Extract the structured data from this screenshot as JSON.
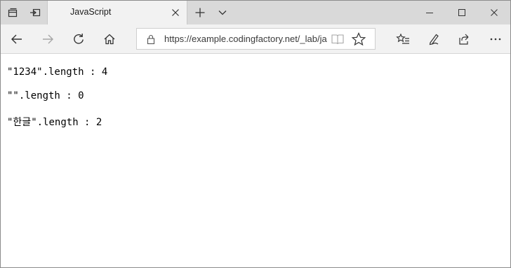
{
  "tab": {
    "title": "JavaScript"
  },
  "address": {
    "url": "https://example.codingfactory.net/_lab/ja"
  },
  "page": {
    "lines": [
      "\"1234\".length : 4",
      "\"\".length : 0",
      "\"한글\".length : 2"
    ]
  },
  "icons": {
    "tab_actions": "tab-actions-icon",
    "set_aside": "set-aside-tabs-icon",
    "close_tab": "close-icon",
    "new_tab": "plus-icon",
    "tab_preview": "chevron-down-icon",
    "minimize": "minimize-icon",
    "maximize": "maximize-icon",
    "close_window": "close-icon",
    "back": "back-arrow-icon",
    "forward": "forward-arrow-icon",
    "refresh": "refresh-icon",
    "home": "home-icon",
    "lock": "lock-icon",
    "reading_view": "book-icon",
    "favorite": "star-icon",
    "favorites_hub": "favorites-list-icon",
    "notes": "pen-icon",
    "share": "share-icon",
    "more": "more-icon"
  },
  "colors": {
    "titlebar": "#d9d9d9",
    "active_tab": "#f2f2f2",
    "navbar": "#f2f2f2",
    "icon": "#333333",
    "disabled_icon": "#a6a6a6"
  }
}
